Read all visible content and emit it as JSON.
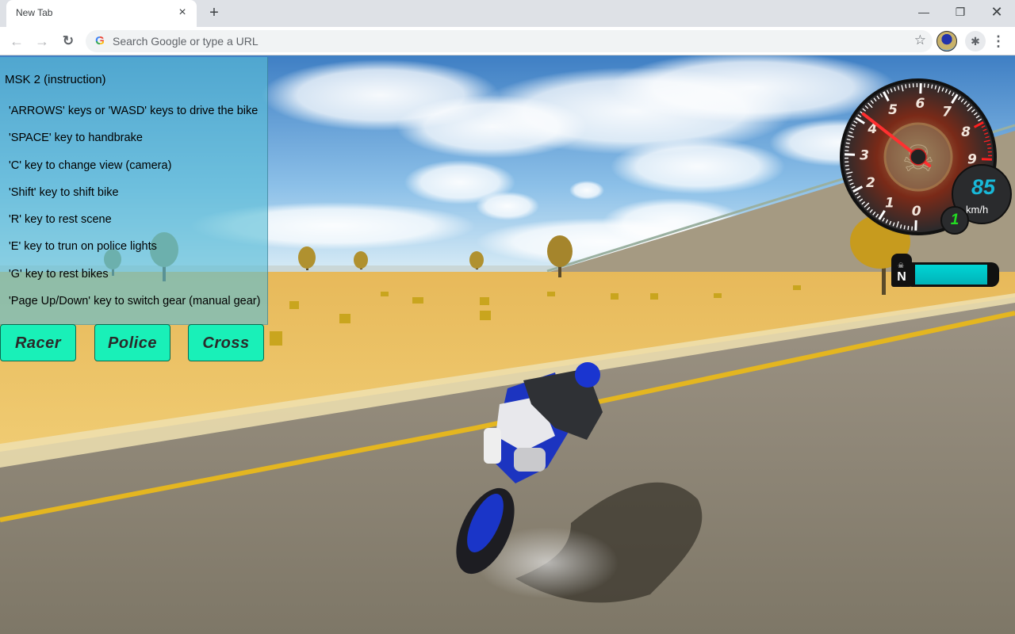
{
  "browser": {
    "tab_title": "New Tab",
    "tab_close_icon": "×",
    "new_tab_icon": "+",
    "window_controls": {
      "minimize": "—",
      "maximize": "❐",
      "close": "✕"
    },
    "nav": {
      "back_icon": "←",
      "forward_icon": "→",
      "reload_icon": "↻"
    },
    "omnibox": {
      "google_icon": "G",
      "placeholder": "Search Google or type a URL",
      "value": "",
      "star_icon": "☆"
    },
    "extensions_icon": "✱",
    "menu_icon": "⋮"
  },
  "game": {
    "instructions": {
      "title": "MSK 2 (instruction)",
      "items": [
        "'ARROWS' keys or 'WASD' keys to drive the bike",
        "'SPACE' key to handbrake",
        "'C' key to change view (camera)",
        "'Shift' key to shift bike",
        "'R' key to rest scene",
        "'E' key to trun on police lights",
        "'G' key to rest bikes",
        "'Page Up/Down' key to switch gear (manual gear)"
      ]
    },
    "bike_buttons": [
      "Racer",
      "Police",
      "Cross"
    ],
    "hud": {
      "tachometer": {
        "labels": [
          "0",
          "1",
          "2",
          "3",
          "4",
          "5",
          "6",
          "7",
          "8",
          "9"
        ],
        "rpm_x1000": 4.2,
        "redline_from": 8,
        "max": 9
      },
      "speed": "85",
      "speed_unit": "km/h",
      "gear": "1",
      "nos": {
        "label": "N",
        "icon": "nitro-bottle",
        "level_percent": 93
      }
    },
    "colors": {
      "button_bg": "#19f0b8",
      "panel_bg": "#5abed7",
      "speed_text": "#18b8d8",
      "gear_text": "#22dd22",
      "nos_fill": "#00c8cc",
      "needle": "#ff3030"
    }
  }
}
